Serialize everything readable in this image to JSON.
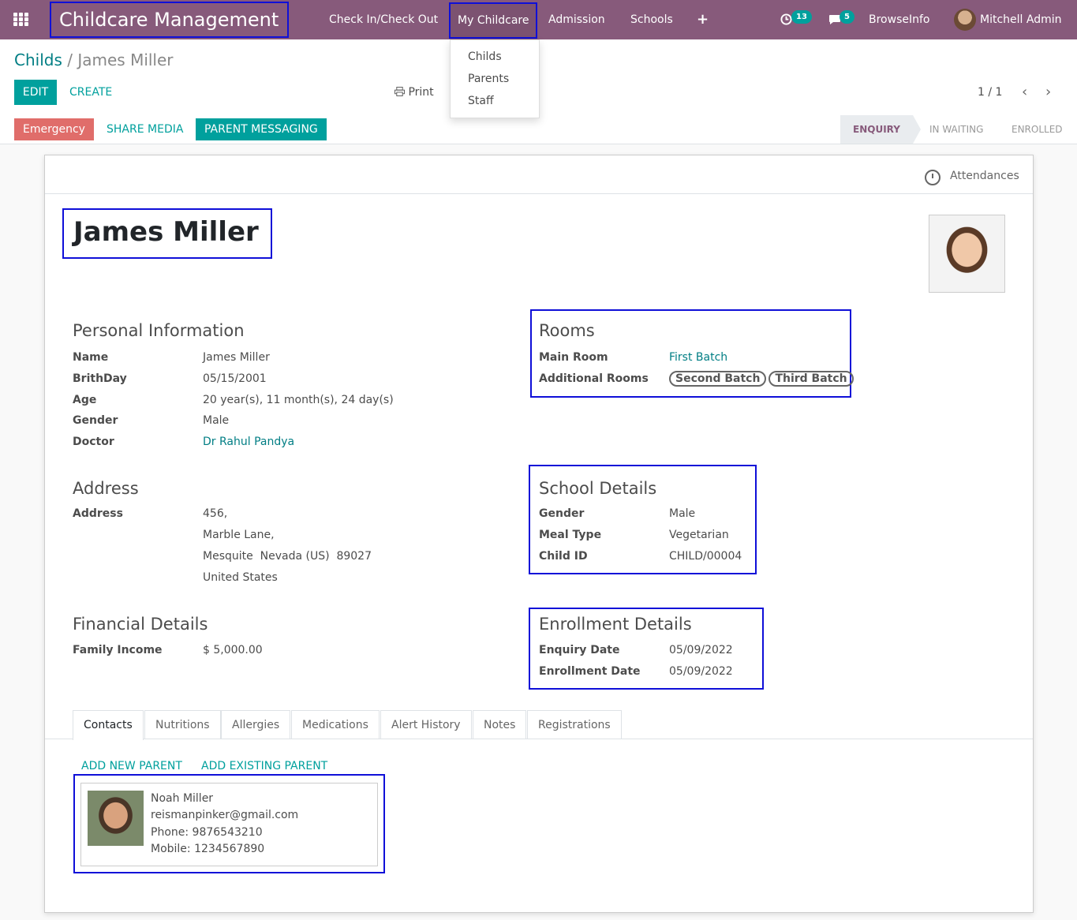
{
  "navbar": {
    "app_title": "Childcare Management",
    "menus": [
      "Check In/Check Out",
      "My Childcare",
      "Admission",
      "Schools"
    ],
    "activity_count": "13",
    "message_count": "5",
    "company": "BrowseInfo",
    "user": "Mitchell Admin"
  },
  "dropdown": {
    "items": [
      "Childs",
      "Parents",
      "Staff"
    ]
  },
  "breadcrumb": {
    "parent": "Childs",
    "separator": "/",
    "current": "James Miller"
  },
  "buttons": {
    "edit": "EDIT",
    "create": "CREATE",
    "print": "Print"
  },
  "pager": {
    "value": "1 / 1"
  },
  "actions": {
    "emergency": "Emergency",
    "share_media": "SHARE MEDIA",
    "parent_messaging": "PARENT MESSAGING"
  },
  "statusbar": [
    "ENQUIRY",
    "IN WAITING",
    "ENROLLED"
  ],
  "smart_button": {
    "attendances": "Attendances"
  },
  "record": {
    "name": "James Miller"
  },
  "personal": {
    "title": "Personal Information",
    "fields": [
      {
        "label": "Name",
        "value": "James Miller"
      },
      {
        "label": "BrithDay",
        "value": "05/15/2001"
      },
      {
        "label": "Age",
        "value": "20 year(s), 11 month(s), 24 day(s)"
      },
      {
        "label": "Gender",
        "value": "Male"
      },
      {
        "label": "Doctor",
        "value": "Dr Rahul Pandya"
      }
    ]
  },
  "rooms": {
    "title": "Rooms",
    "main_label": "Main Room",
    "main_value": "First Batch",
    "additional_label": "Additional Rooms",
    "additional_tags": [
      "Second Batch",
      "Third Batch"
    ]
  },
  "address": {
    "title": "Address",
    "label": "Address",
    "lines": [
      "456,",
      "Marble Lane,",
      "Mesquite  Nevada (US)  89027",
      "United States"
    ]
  },
  "school": {
    "title": "School Details",
    "fields": [
      {
        "label": "Gender",
        "value": "Male"
      },
      {
        "label": "Meal Type",
        "value": "Vegetarian"
      },
      {
        "label": "Child ID",
        "value": "CHILD/00004"
      }
    ]
  },
  "financial": {
    "title": "Financial Details",
    "label": "Family Income",
    "value": "$ 5,000.00"
  },
  "enrollment": {
    "title": "Enrollment Details",
    "fields": [
      {
        "label": "Enquiry Date",
        "value": "05/09/2022"
      },
      {
        "label": "Enrollment Date",
        "value": "05/09/2022"
      }
    ]
  },
  "tabs": [
    "Contacts",
    "Nutritions",
    "Allergies",
    "Medications",
    "Alert History",
    "Notes",
    "Registrations"
  ],
  "contacts": {
    "add_new": "ADD NEW PARENT",
    "add_existing": "ADD EXISTING PARENT",
    "parent": {
      "name": "Noah Miller",
      "email": "reismanpinker@gmail.com",
      "phone": "Phone: 9876543210",
      "mobile": "Mobile: 1234567890"
    }
  },
  "colors": {
    "brand": "#875a7b",
    "accent": "#00a09d",
    "danger": "#e06d6a",
    "highlight": "#0f0fd8"
  }
}
